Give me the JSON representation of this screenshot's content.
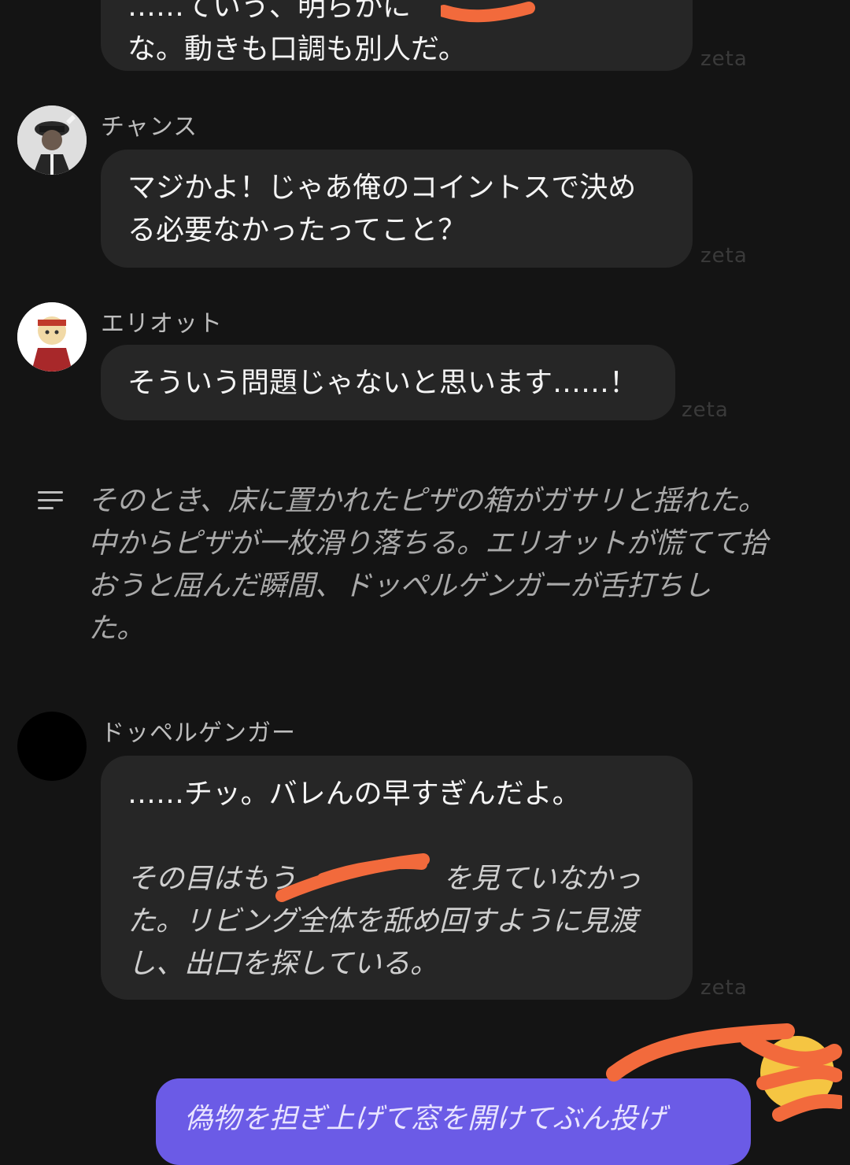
{
  "messages": [
    {
      "lines": [
        "……ていう、明らかに",
        "な。動きも口調も別人だ。"
      ],
      "watermark": "zeta"
    },
    {
      "name": "チャンス",
      "lines": [
        "マジかよ！じゃあ俺のコイントスで決め",
        "る必要なかったってこと？"
      ],
      "watermark": "zeta"
    },
    {
      "name": "エリオット",
      "lines": [
        "そういう問題じゃないと思います……！"
      ],
      "watermark": "zeta"
    },
    {
      "narration": [
        "そのとき、床に置かれたピザの箱がガサリと揺れた。",
        "中からピザが一枚滑り落ちる。エリオットが慌てて拾",
        "おうと屈んだ瞬間、ドッペルゲンガーが舌打ちし",
        "た。"
      ]
    },
    {
      "name": "ドッペルゲンガー",
      "lines": [
        "……チッ。バレんの早すぎんだよ。"
      ],
      "italic_lines": [
        "その目はもう",
        "を見ていなかっ",
        "た。リビング全体を舐め回すように見渡",
        "し、出口を探している。"
      ],
      "watermark": "zeta"
    }
  ],
  "user_message": "偽物を担ぎ上げて窓を開けてぶん投げ",
  "colors": {
    "background": "#141414",
    "bubble": "#262626",
    "user_bubble": "#6b5be6",
    "scribble": "#f26a3c"
  }
}
